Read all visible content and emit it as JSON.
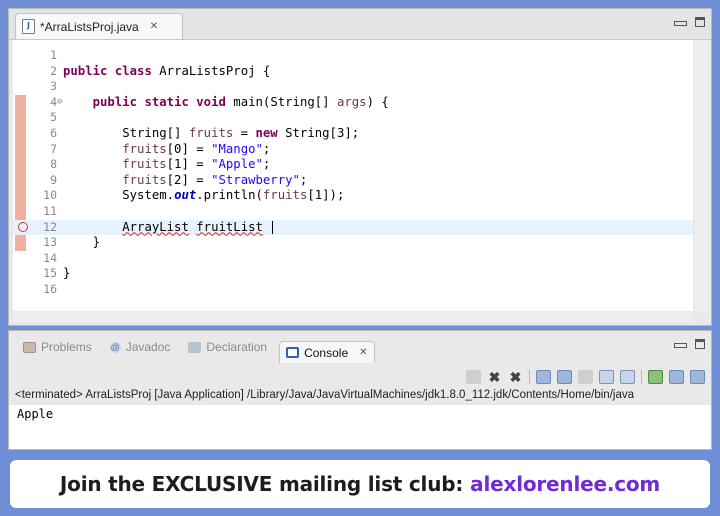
{
  "editor": {
    "tab_label": "*ArraListsProj.java",
    "tab_icon": "java-file-icon",
    "lines": [
      {
        "n": "1",
        "tokens": []
      },
      {
        "n": "2",
        "tokens": [
          {
            "t": "public",
            "c": "kw"
          },
          {
            "t": " "
          },
          {
            "t": "class",
            "c": "kw"
          },
          {
            "t": " ArraListsProj {"
          }
        ]
      },
      {
        "n": "3",
        "tokens": []
      },
      {
        "n": "4",
        "fold": true,
        "tokens": [
          {
            "t": "    "
          },
          {
            "t": "public",
            "c": "kw"
          },
          {
            "t": " "
          },
          {
            "t": "static",
            "c": "kw"
          },
          {
            "t": " "
          },
          {
            "t": "void",
            "c": "kw"
          },
          {
            "t": " main(String[] "
          },
          {
            "t": "args",
            "c": "lvar"
          },
          {
            "t": ") {"
          }
        ]
      },
      {
        "n": "5",
        "tokens": []
      },
      {
        "n": "6",
        "tokens": [
          {
            "t": "        String[] "
          },
          {
            "t": "fruits",
            "c": "lvar"
          },
          {
            "t": " = "
          },
          {
            "t": "new",
            "c": "kw"
          },
          {
            "t": " String[3];"
          }
        ]
      },
      {
        "n": "7",
        "tokens": [
          {
            "t": "        "
          },
          {
            "t": "fruits",
            "c": "lvar"
          },
          {
            "t": "[0] = "
          },
          {
            "t": "\"Mango\"",
            "c": "str"
          },
          {
            "t": ";"
          }
        ]
      },
      {
        "n": "8",
        "tokens": [
          {
            "t": "        "
          },
          {
            "t": "fruits",
            "c": "lvar"
          },
          {
            "t": "[1] = "
          },
          {
            "t": "\"Apple\"",
            "c": "str"
          },
          {
            "t": ";"
          }
        ]
      },
      {
        "n": "9",
        "tokens": [
          {
            "t": "        "
          },
          {
            "t": "fruits",
            "c": "lvar"
          },
          {
            "t": "[2] = "
          },
          {
            "t": "\"Strawberry\"",
            "c": "str"
          },
          {
            "t": ";"
          }
        ]
      },
      {
        "n": "10",
        "tokens": [
          {
            "t": "        System."
          },
          {
            "t": "out",
            "c": "sfld"
          },
          {
            "t": ".println("
          },
          {
            "t": "fruits",
            "c": "lvar"
          },
          {
            "t": "[1]);"
          }
        ]
      },
      {
        "n": "11",
        "tokens": []
      },
      {
        "n": "12",
        "current": true,
        "error": true,
        "tokens": [
          {
            "t": "        "
          },
          {
            "t": "ArrayList",
            "c": "err"
          },
          {
            "t": " "
          },
          {
            "t": "fruitList",
            "c": "err"
          },
          {
            "t": " "
          }
        ]
      },
      {
        "n": "13",
        "tokens": [
          {
            "t": "    }"
          }
        ]
      },
      {
        "n": "14",
        "tokens": []
      },
      {
        "n": "15",
        "tokens": [
          {
            "t": "}"
          }
        ]
      },
      {
        "n": "16",
        "tokens": []
      }
    ]
  },
  "views": {
    "tabs": [
      {
        "label": "Problems",
        "icon": "problems-icon",
        "active": false
      },
      {
        "label": "Javadoc",
        "icon": "javadoc-icon",
        "active": false
      },
      {
        "label": "Declaration",
        "icon": "declaration-icon",
        "active": false
      },
      {
        "label": "Console",
        "icon": "console-icon",
        "active": true
      }
    ]
  },
  "console": {
    "status": "<terminated> ArraListsProj [Java Application] /Library/Java/JavaVirtualMachines/jdk1.8.0_112.jdk/Contents/Home/bin/java",
    "output": "Apple"
  },
  "banner": {
    "text": "Join the EXCLUSIVE mailing list club:",
    "link": "alexlorenlee.com"
  },
  "colors": {
    "background": "#6e8fd6",
    "keyword": "#7f0055",
    "string": "#2a00ff",
    "banner_link": "#6f2bd6"
  }
}
